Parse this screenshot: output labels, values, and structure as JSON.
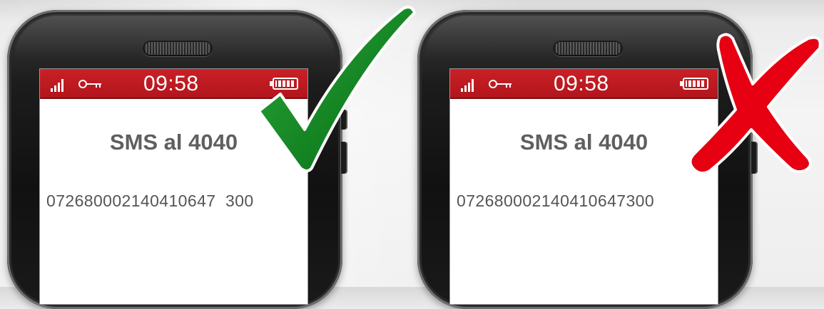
{
  "phones": [
    {
      "status_time": "09:58",
      "sms_title": "SMS al 4040",
      "sms_body": "072680002140410647  300",
      "verdict": "check-icon",
      "verdict_color": "#0a7a18"
    },
    {
      "status_time": "09:58",
      "sms_title": "SMS al 4040",
      "sms_body": "072680002140410647300",
      "verdict": "cross-icon",
      "verdict_color": "#e60012"
    }
  ],
  "colors": {
    "status_bar": "#c92027",
    "text": "#5f5f5f",
    "check": "#0a7a18",
    "cross": "#e60012"
  },
  "icons": [
    "signal-icon",
    "key-icon",
    "battery-icon",
    "check-icon",
    "cross-icon"
  ]
}
